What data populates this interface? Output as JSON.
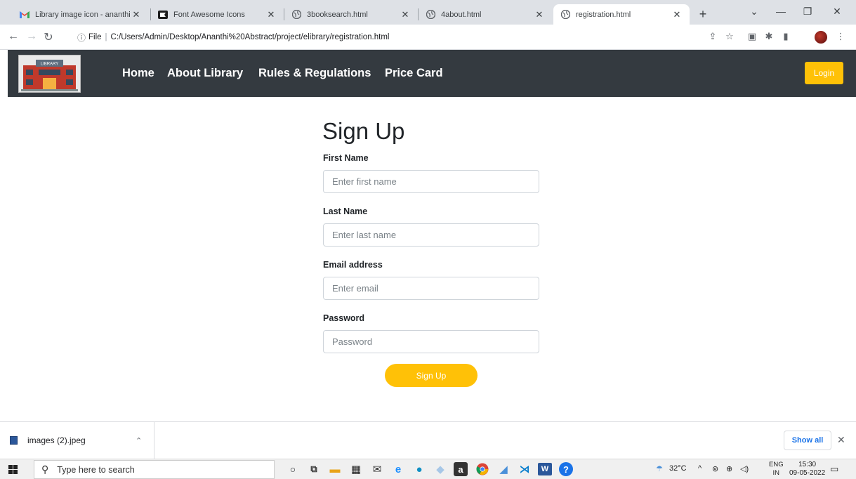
{
  "browser": {
    "tabs": [
      {
        "title": "Library image icon - ananthis",
        "favicon": "gmail-icon",
        "active": false
      },
      {
        "title": "Font Awesome Icons",
        "favicon": "font-awesome-icon",
        "active": false
      },
      {
        "title": "3booksearch.html",
        "favicon": "globe-icon",
        "active": false
      },
      {
        "title": "4about.html",
        "favicon": "globe-icon",
        "active": false
      },
      {
        "title": "registration.html",
        "favicon": "globe-icon",
        "active": true
      }
    ],
    "address": {
      "scheme_label": "File",
      "url": "C:/Users/Admin/Desktop/Ananthi%20Abstract/project/elibrary/registration.html"
    }
  },
  "site": {
    "logo_text": "LIBRARY",
    "nav": [
      "Home",
      "About Library",
      "Rules & Regulations",
      "Price Card"
    ],
    "login_label": "Login"
  },
  "form": {
    "title": "Sign Up",
    "fields": [
      {
        "label": "First Name",
        "placeholder": "Enter first name"
      },
      {
        "label": "Last Name",
        "placeholder": "Enter last name"
      },
      {
        "label": "Email address",
        "placeholder": "Enter email"
      },
      {
        "label": "Password",
        "placeholder": "Password"
      }
    ],
    "submit_label": "Sign Up"
  },
  "downloads": {
    "file_name": "images (2).jpeg",
    "show_all_label": "Show all"
  },
  "taskbar": {
    "search_placeholder": "Type here to search",
    "weather": "32°C",
    "language": "ENG",
    "region": "IN",
    "time": "15:30",
    "date": "09-05-2022"
  },
  "colors": {
    "navbar_bg": "#343a40",
    "accent_yellow": "#ffc107",
    "tabstrip_bg": "#dee1e6"
  }
}
